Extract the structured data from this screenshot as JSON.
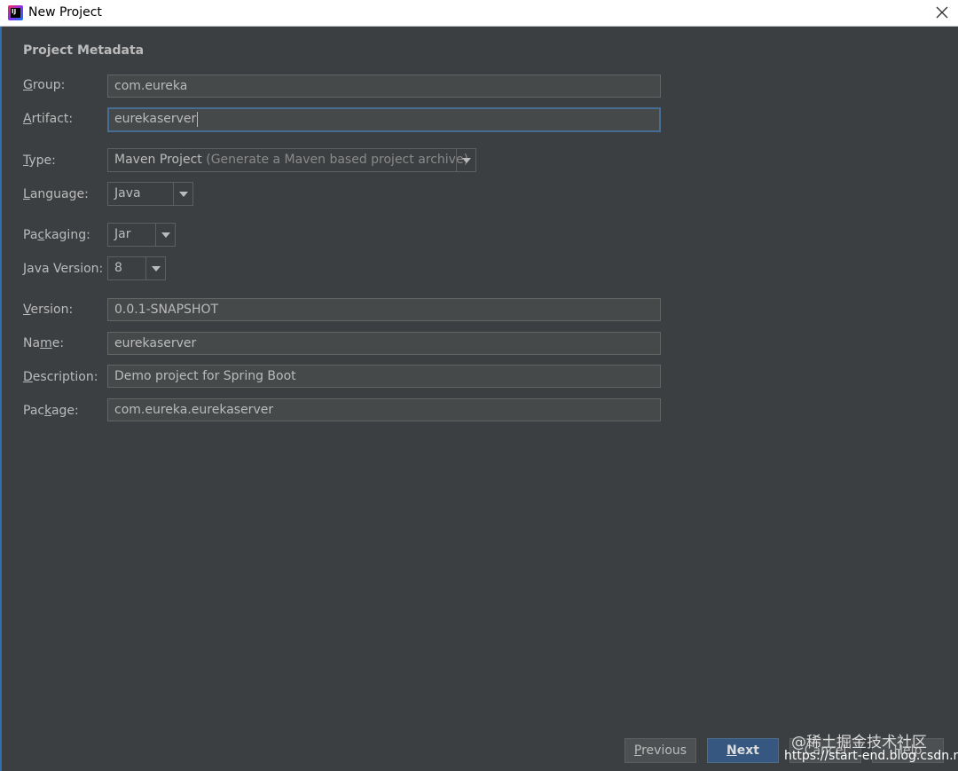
{
  "window": {
    "title": "New Project",
    "icon_text": "IJ"
  },
  "section_title": "Project Metadata",
  "fields": {
    "group": {
      "label_mn": "G",
      "label_rest": "roup:",
      "value": "com.eureka"
    },
    "artifact": {
      "label_mn": "A",
      "label_rest": "rtifact:",
      "value": "eurekaserver"
    },
    "version": {
      "label_mn": "V",
      "label_rest": "ersion:",
      "value": "0.0.1-SNAPSHOT"
    },
    "name": {
      "label_pre": "Na",
      "label_mn": "m",
      "label_rest": "e:",
      "value": "eurekaserver"
    },
    "description": {
      "label_mn": "D",
      "label_rest": "escription:",
      "value": "Demo project for Spring Boot"
    },
    "package": {
      "label_pre": "Pac",
      "label_mn": "k",
      "label_rest": "age:",
      "value": "com.eureka.eurekaserver"
    }
  },
  "dropdowns": {
    "type": {
      "label_mn": "T",
      "label_rest": "ype:",
      "value": "Maven Project",
      "hint": "(Generate a Maven based project archive)"
    },
    "language": {
      "label_mn": "L",
      "label_rest": "anguage:",
      "value": "Java"
    },
    "packaging": {
      "label_pre": "Pa",
      "label_mn": "c",
      "label_rest": "kaging:",
      "value": "Jar"
    },
    "java_version": {
      "label_mn": "J",
      "label_rest": "ava Version:",
      "value": "8"
    }
  },
  "buttons": {
    "previous": {
      "mn": "P",
      "rest": "revious"
    },
    "next": {
      "mn": "N",
      "rest": "ext"
    },
    "cancel": {
      "label": "Cancel"
    },
    "help": {
      "label": "Help"
    }
  },
  "watermark": {
    "line1": "@稀土掘金技术社区",
    "line2": "https://start-end.blog.csdn.net"
  },
  "colors": {
    "background": "#3c3f41",
    "field_bg": "#45494a",
    "focus_border": "#466d94",
    "primary_button": "#365880",
    "text": "#bbbbbb"
  }
}
